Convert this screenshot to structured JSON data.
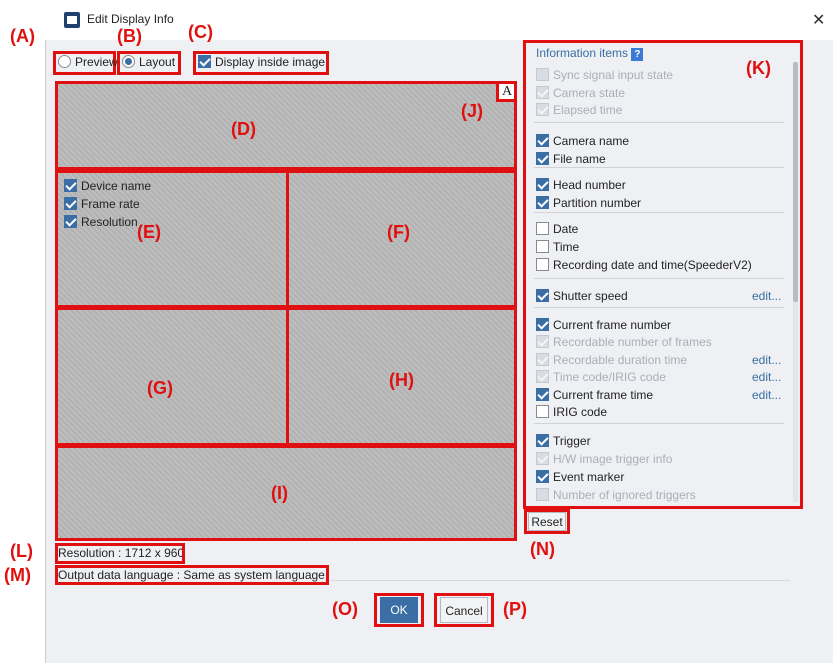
{
  "window": {
    "title": "Edit Display Info"
  },
  "callouts": [
    "(A)",
    "(B)",
    "(C)",
    "(D)",
    "(E)",
    "(F)",
    "(G)",
    "(H)",
    "(I)",
    "(J)",
    "(K)",
    "(L)",
    "(M)",
    "(N)",
    "(O)",
    "(P)"
  ],
  "modes": {
    "preview": "Preview",
    "layout": "Layout",
    "display_inside": "Display inside image"
  },
  "layout_panel_e": {
    "items": [
      "Device name",
      "Frame rate",
      "Resolution"
    ]
  },
  "corner_icon": "A",
  "info": {
    "header": "Information items",
    "help_badge": "?",
    "items": [
      {
        "label": "Sync signal input state",
        "checked": false,
        "dim": true
      },
      {
        "label": "Camera state",
        "checked": true,
        "dim": true
      },
      {
        "label": "Elapsed time",
        "checked": true,
        "dim": true
      },
      {
        "label": "Camera name",
        "checked": true,
        "dim": false
      },
      {
        "label": "File name",
        "checked": true,
        "dim": false
      },
      {
        "label": "Head number",
        "checked": true,
        "dim": false
      },
      {
        "label": "Partition number",
        "checked": true,
        "dim": false
      },
      {
        "label": "Date",
        "checked": false,
        "dim": false
      },
      {
        "label": "Time",
        "checked": false,
        "dim": false
      },
      {
        "label": "Recording date and time(SpeederV2)",
        "checked": false,
        "dim": false
      },
      {
        "label": "Shutter speed",
        "checked": true,
        "dim": false,
        "edit": "edit..."
      },
      {
        "label": "Current frame number",
        "checked": true,
        "dim": false
      },
      {
        "label": "Recordable number of frames",
        "checked": true,
        "dim": true
      },
      {
        "label": "Recordable duration time",
        "checked": true,
        "dim": true,
        "edit": "edit..."
      },
      {
        "label": "Time code/IRIG code",
        "checked": true,
        "dim": true,
        "edit": "edit..."
      },
      {
        "label": "Current frame time",
        "checked": true,
        "dim": false,
        "edit": "edit..."
      },
      {
        "label": "IRIG code",
        "checked": false,
        "dim": false
      },
      {
        "label": "Trigger",
        "checked": true,
        "dim": false
      },
      {
        "label": "H/W image trigger info",
        "checked": true,
        "dim": true
      },
      {
        "label": "Event marker",
        "checked": true,
        "dim": false
      },
      {
        "label": "Number of ignored triggers",
        "checked": false,
        "dim": true
      }
    ]
  },
  "reset_label": "Reset",
  "status": {
    "resolution": "Resolution : 1712 x 960",
    "language": "Output data language : Same as system language"
  },
  "buttons": {
    "ok": "OK",
    "cancel": "Cancel"
  }
}
